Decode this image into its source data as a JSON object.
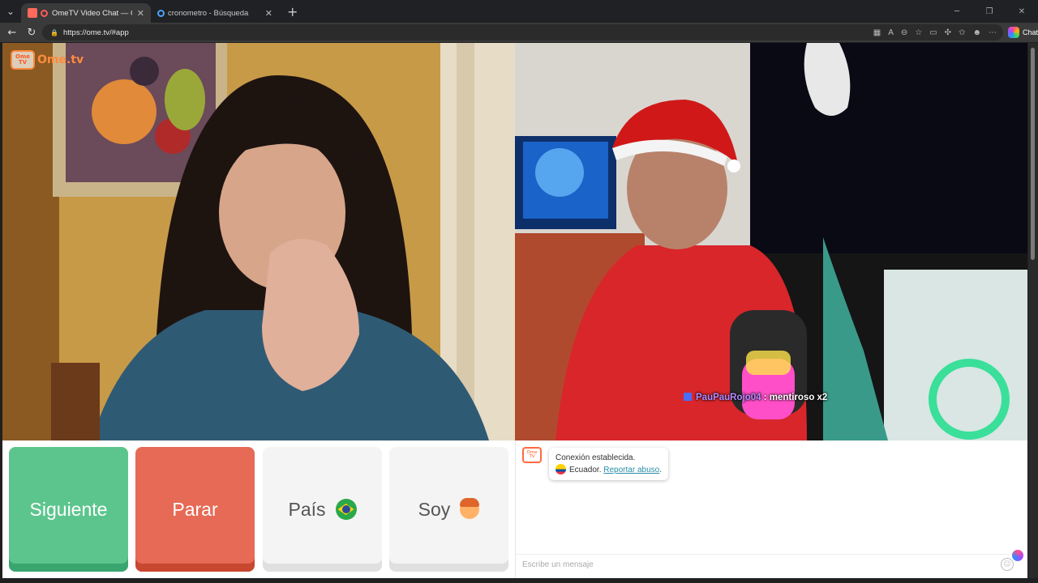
{
  "browser": {
    "tabs": [
      {
        "title": "OmeTV Video Chat — Omegle",
        "active": true
      },
      {
        "title": "cronometro - Búsqueda",
        "active": false
      }
    ],
    "url": "https://ome.tv/#app",
    "chat_button_label": "Chat"
  },
  "app": {
    "brand": "Ome.tv",
    "brand_icon_text": "Ome TV",
    "overlay_message": {
      "user": "PauPauRojo04",
      "text": " : mentiroso x2"
    },
    "controls": {
      "next_label": "Siguiente",
      "stop_label": "Parar",
      "country_label": "País",
      "gender_label": "Soy"
    },
    "chat": {
      "connection_text": "Conexión establecida.",
      "country_name": "Ecuador.",
      "report_link": "Reportar abuso",
      "report_suffix": ".",
      "input_placeholder": "Escribe un mensaje"
    }
  },
  "colors": {
    "next": "#5cc58d",
    "stop": "#e66a55",
    "brand": "#ff8a3d",
    "link": "#2a8fa8"
  },
  "icons": {
    "country_flag": "brazil-flag-icon",
    "gender_avatar": "boy-face-icon",
    "chat_country_flag": "ecuador-flag-icon"
  }
}
